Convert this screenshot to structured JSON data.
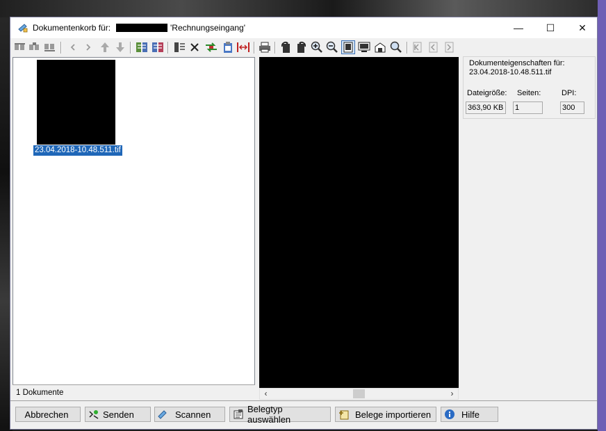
{
  "window": {
    "title_prefix": "Dokumentenkorb für:",
    "title_suffix": "'Rechnungseingang'",
    "controls": {
      "minimize": "—",
      "maximize": "☐",
      "close": "✕"
    }
  },
  "toolbar": {
    "icons": [
      "move-first-icon",
      "move-prev-group-icon",
      "move-next-group-icon",
      "arrow-left-icon",
      "arrow-right-icon",
      "arrow-up-icon",
      "arrow-down-icon",
      "split-document-icon",
      "merge-document-icon",
      "document-list-icon",
      "delete-icon",
      "transfer-icon",
      "clipboard-icon",
      "split-page-icon",
      "print-icon",
      "rotate-left-icon",
      "rotate-right-icon",
      "zoom-in-icon",
      "zoom-out-icon",
      "fit-page-icon",
      "fit-width-icon",
      "export-icon",
      "find-icon",
      "first-page-icon",
      "prev-page-icon",
      "next-page-icon"
    ]
  },
  "documents": {
    "items": [
      {
        "name": "23.04.2018-10.48.511.tif",
        "selected": true
      }
    ],
    "status": "1 Dokumente"
  },
  "viewer": {
    "scroll_left": "‹",
    "scroll_right": "›"
  },
  "properties": {
    "heading": "Dokumenteigenschaften für:",
    "filename": "23.04.2018-10.48.511.tif",
    "size_label": "Dateigröße:",
    "size_value": "363,90 KB",
    "pages_label": "Seiten:",
    "pages_value": "1",
    "dpi_label": "DPI:",
    "dpi_value": "300"
  },
  "buttons": {
    "cancel": "Abbrechen",
    "send": "Senden",
    "scan": "Scannen",
    "doctype": "Belegtyp auswählen",
    "import": "Belege importieren",
    "help": "Hilfe"
  },
  "colors": {
    "selection": "#1f67b8",
    "viewer_bg": "#000000",
    "accent_purple": "#6f5fb5"
  }
}
